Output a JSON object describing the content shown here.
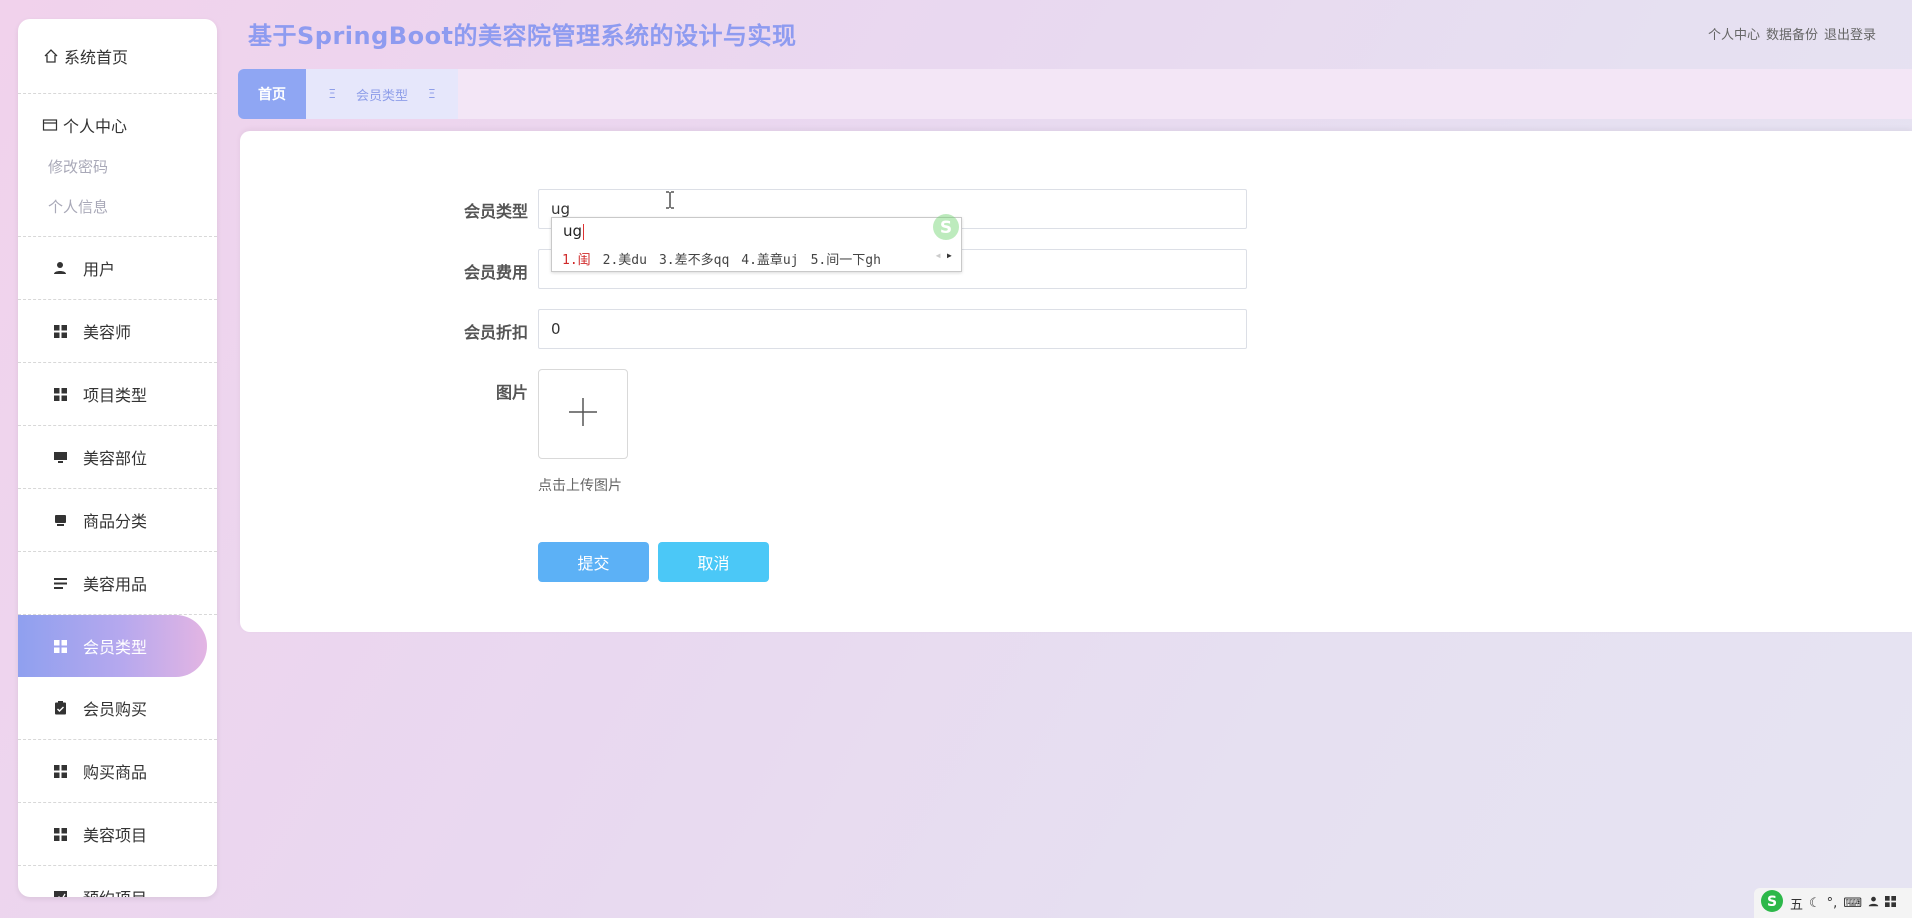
{
  "header": {
    "title": "基于SpringBoot的美容院管理系统的设计与实现",
    "links": [
      "个人中心",
      "数据备份",
      "退出登录"
    ]
  },
  "sidebar": {
    "home": "系统首页",
    "personal": {
      "label": "个人中心",
      "sub": [
        "修改密码",
        "个人信息"
      ]
    },
    "items": [
      {
        "label": "用户",
        "icon": "user-icon"
      },
      {
        "label": "美容师",
        "icon": "grid-icon"
      },
      {
        "label": "项目类型",
        "icon": "grid-icon"
      },
      {
        "label": "美容部位",
        "icon": "monitor-icon"
      },
      {
        "label": "商品分类",
        "icon": "monitor-icon"
      },
      {
        "label": "美容用品",
        "icon": "list-icon"
      },
      {
        "label": "会员类型",
        "icon": "grid-icon",
        "active": true
      },
      {
        "label": "会员购买",
        "icon": "clipboard-check-icon"
      },
      {
        "label": "购买商品",
        "icon": "grid-icon"
      },
      {
        "label": "美容项目",
        "icon": "grid-icon"
      },
      {
        "label": "预约项目",
        "icon": "chart-icon"
      }
    ]
  },
  "tabs": {
    "home": "首页",
    "member_type": "会员类型"
  },
  "form": {
    "member_type": {
      "label": "会员类型",
      "value": "ug"
    },
    "member_fee": {
      "label": "会员费用"
    },
    "member_discount": {
      "label": "会员折扣",
      "value": "0"
    },
    "image": {
      "label": "图片",
      "hint": "点击上传图片"
    },
    "submit": "提交",
    "cancel": "取消"
  },
  "ime": {
    "composition": "ug",
    "candidates": [
      "1.闺",
      "2.美du",
      "3.差不多qq",
      "4.盖章uj",
      "5.间一下gh"
    ]
  },
  "tray": {
    "mode": "五"
  },
  "colors": {
    "accent": "#8e9bf0",
    "tab_home": "#8fa6f3",
    "submit": "#5cb1f6",
    "cancel": "#4bc8f7"
  }
}
